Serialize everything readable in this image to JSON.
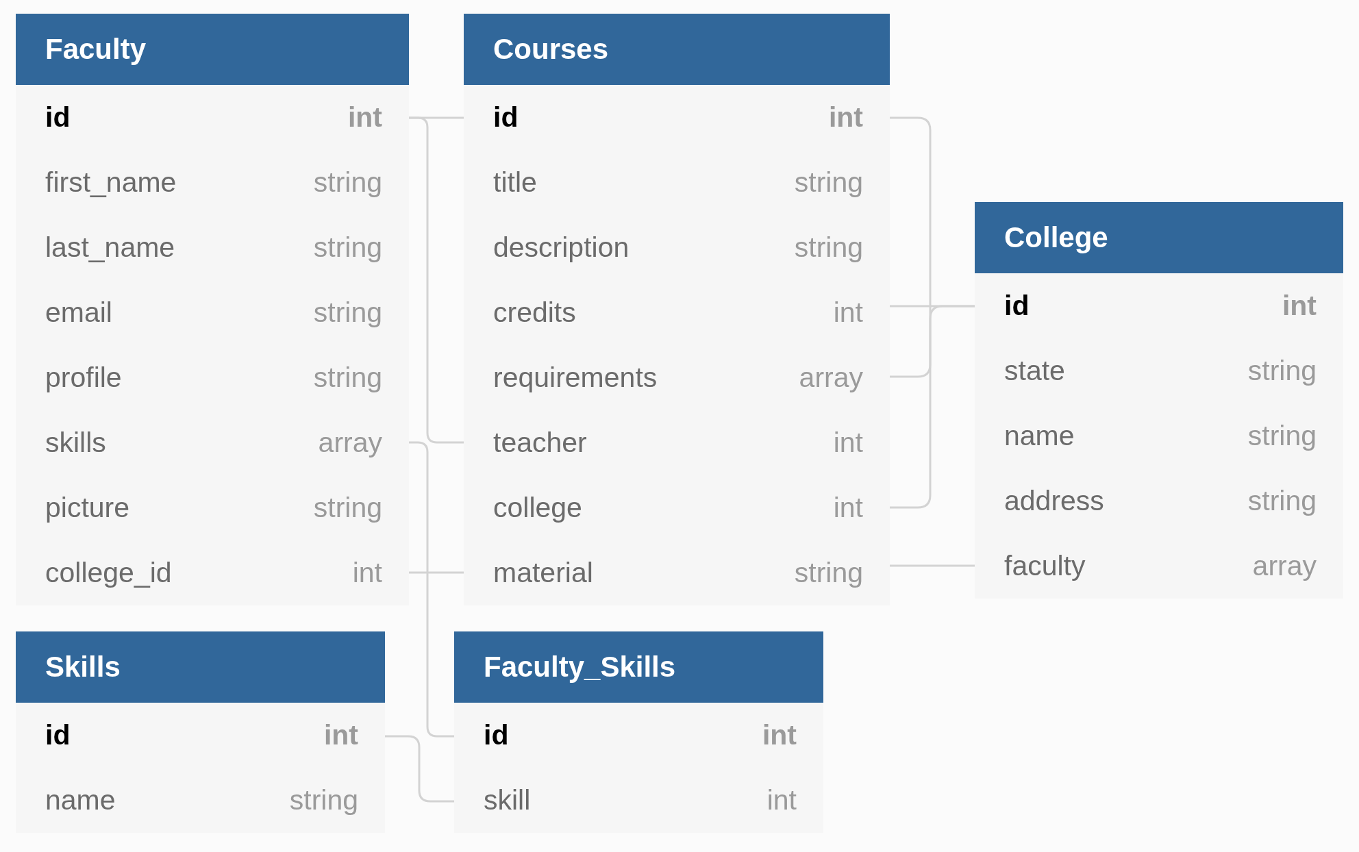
{
  "tables": [
    {
      "name": "Faculty",
      "fields": [
        {
          "name": "id",
          "type": "int",
          "primary": true
        },
        {
          "name": "first_name",
          "type": "string",
          "primary": false
        },
        {
          "name": "last_name",
          "type": "string",
          "primary": false
        },
        {
          "name": "email",
          "type": "string",
          "primary": false
        },
        {
          "name": "profile",
          "type": "string",
          "primary": false
        },
        {
          "name": "skills",
          "type": "array",
          "primary": false
        },
        {
          "name": "picture",
          "type": "string",
          "primary": false
        },
        {
          "name": "college_id",
          "type": "int",
          "primary": false
        }
      ]
    },
    {
      "name": "Courses",
      "fields": [
        {
          "name": "id",
          "type": "int",
          "primary": true
        },
        {
          "name": "title",
          "type": "string",
          "primary": false
        },
        {
          "name": "description",
          "type": "string",
          "primary": false
        },
        {
          "name": "credits",
          "type": "int",
          "primary": false
        },
        {
          "name": "requirements",
          "type": "array",
          "primary": false
        },
        {
          "name": "teacher",
          "type": "int",
          "primary": false
        },
        {
          "name": "college",
          "type": "int",
          "primary": false
        },
        {
          "name": "material",
          "type": "string",
          "primary": false
        }
      ]
    },
    {
      "name": "College",
      "fields": [
        {
          "name": "id",
          "type": "int",
          "primary": true
        },
        {
          "name": "state",
          "type": "string",
          "primary": false
        },
        {
          "name": "name",
          "type": "string",
          "primary": false
        },
        {
          "name": "address",
          "type": "string",
          "primary": false
        },
        {
          "name": "faculty",
          "type": "array",
          "primary": false
        }
      ]
    },
    {
      "name": "Skills",
      "fields": [
        {
          "name": "id",
          "type": "int",
          "primary": true
        },
        {
          "name": "name",
          "type": "string",
          "primary": false
        }
      ]
    },
    {
      "name": "Faculty_Skills",
      "fields": [
        {
          "name": "id",
          "type": "int",
          "primary": true
        },
        {
          "name": "skill",
          "type": "int",
          "primary": false
        }
      ]
    }
  ]
}
